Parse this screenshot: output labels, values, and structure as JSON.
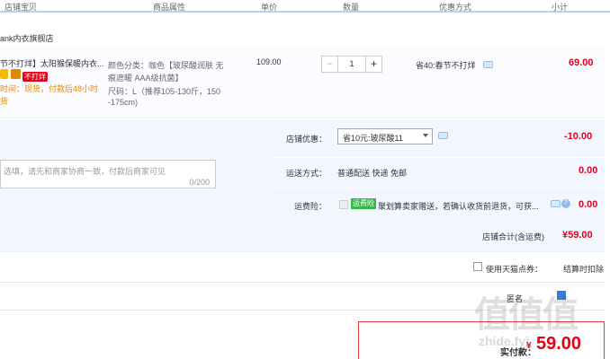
{
  "header": {
    "col_shop": "店铺宝贝",
    "col_attr": "商品属性",
    "col_price": "单价",
    "col_qty": "数量",
    "col_promo": "优惠方式",
    "col_subtotal": "小计"
  },
  "shop_name": "ank内衣旗舰店",
  "item": {
    "title": "节不打烊】太阳猴保暖内衣...",
    "badge": "不打烊",
    "delivery_line1": "时间：现货，付款后48小时",
    "delivery_line2": "货",
    "attr_color_line1": "颜色分类：咖色【玻尿酸润肤 无",
    "attr_color_line2": "痕遮暖 AAA级抗菌】",
    "attr_size_line1": "尺码：L（推荐105-130斤，150",
    "attr_size_line2": "-175cm)",
    "price": "109.00",
    "quantity": "1",
    "minus": "−",
    "plus": "+",
    "promo": "省40:春节不打烊",
    "subtotal": "69.00"
  },
  "shop_discount": {
    "label": "店铺优惠：",
    "selected": "省10元:玻尿酸11",
    "amount": "-10.00"
  },
  "note": {
    "placeholder": "选填，请先和商家协商一致，付款后商家可见",
    "counter": "0/200"
  },
  "shipping": {
    "label": "运送方式：",
    "value": "普通配送 快递 免邮",
    "amount": "0.00"
  },
  "insurance": {
    "label": "运费险：",
    "badge": "运费险",
    "text": "聚划算卖家赠送，若确认收货前退货，可获...",
    "amount": "0.00"
  },
  "shop_total": {
    "label": "店铺合计(含运费)",
    "amount": "¥59.00"
  },
  "coupon": {
    "label": "使用天猫点券：",
    "note": "结算时扣除"
  },
  "anon_label": "匿名",
  "final": {
    "label": "实付款：",
    "amount": "59.00"
  },
  "watermark": {
    "text": "值值值",
    "url": "zhide.fyi"
  },
  "colors": {
    "accent_red": "#e40019",
    "header_border": "#b2d1ff",
    "section_bg": "#f2f7ff"
  }
}
